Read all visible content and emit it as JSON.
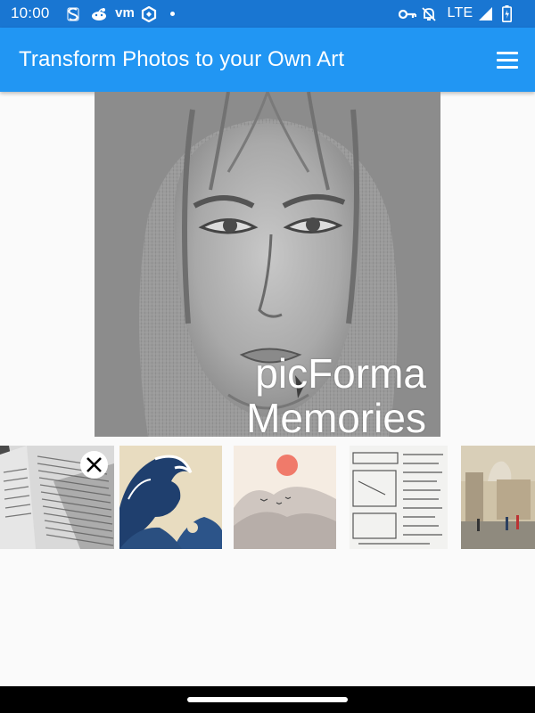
{
  "status_bar": {
    "time": "10:00",
    "vm_label": "vm",
    "network_label": "LTE",
    "icons": [
      "s-app-icon",
      "reddit-icon",
      "vm-icon",
      "hexagon-app-icon",
      "notification-dot-icon",
      "vpn-key-icon",
      "notifications-off-icon",
      "signal-icon",
      "battery-icon"
    ]
  },
  "app_bar": {
    "title": "Transform Photos to your Own Art",
    "menu_icon": "hamburger-menu-icon"
  },
  "preview": {
    "description_icon": "pencil-sketch-portrait",
    "watermark_line1": "picForma",
    "watermark_line2": "Memories"
  },
  "thumbnails": [
    {
      "name": "document-photo",
      "selected": true
    },
    {
      "name": "great-wave"
    },
    {
      "name": "misty-mountains-red-sun"
    },
    {
      "name": "hand-drawn-sketch-notes"
    },
    {
      "name": "impressionist-street-painting"
    }
  ],
  "colors": {
    "status_bar": "#1976d2",
    "app_bar": "#2196f3",
    "background": "#fafafa",
    "nav_bar": "#000000"
  }
}
